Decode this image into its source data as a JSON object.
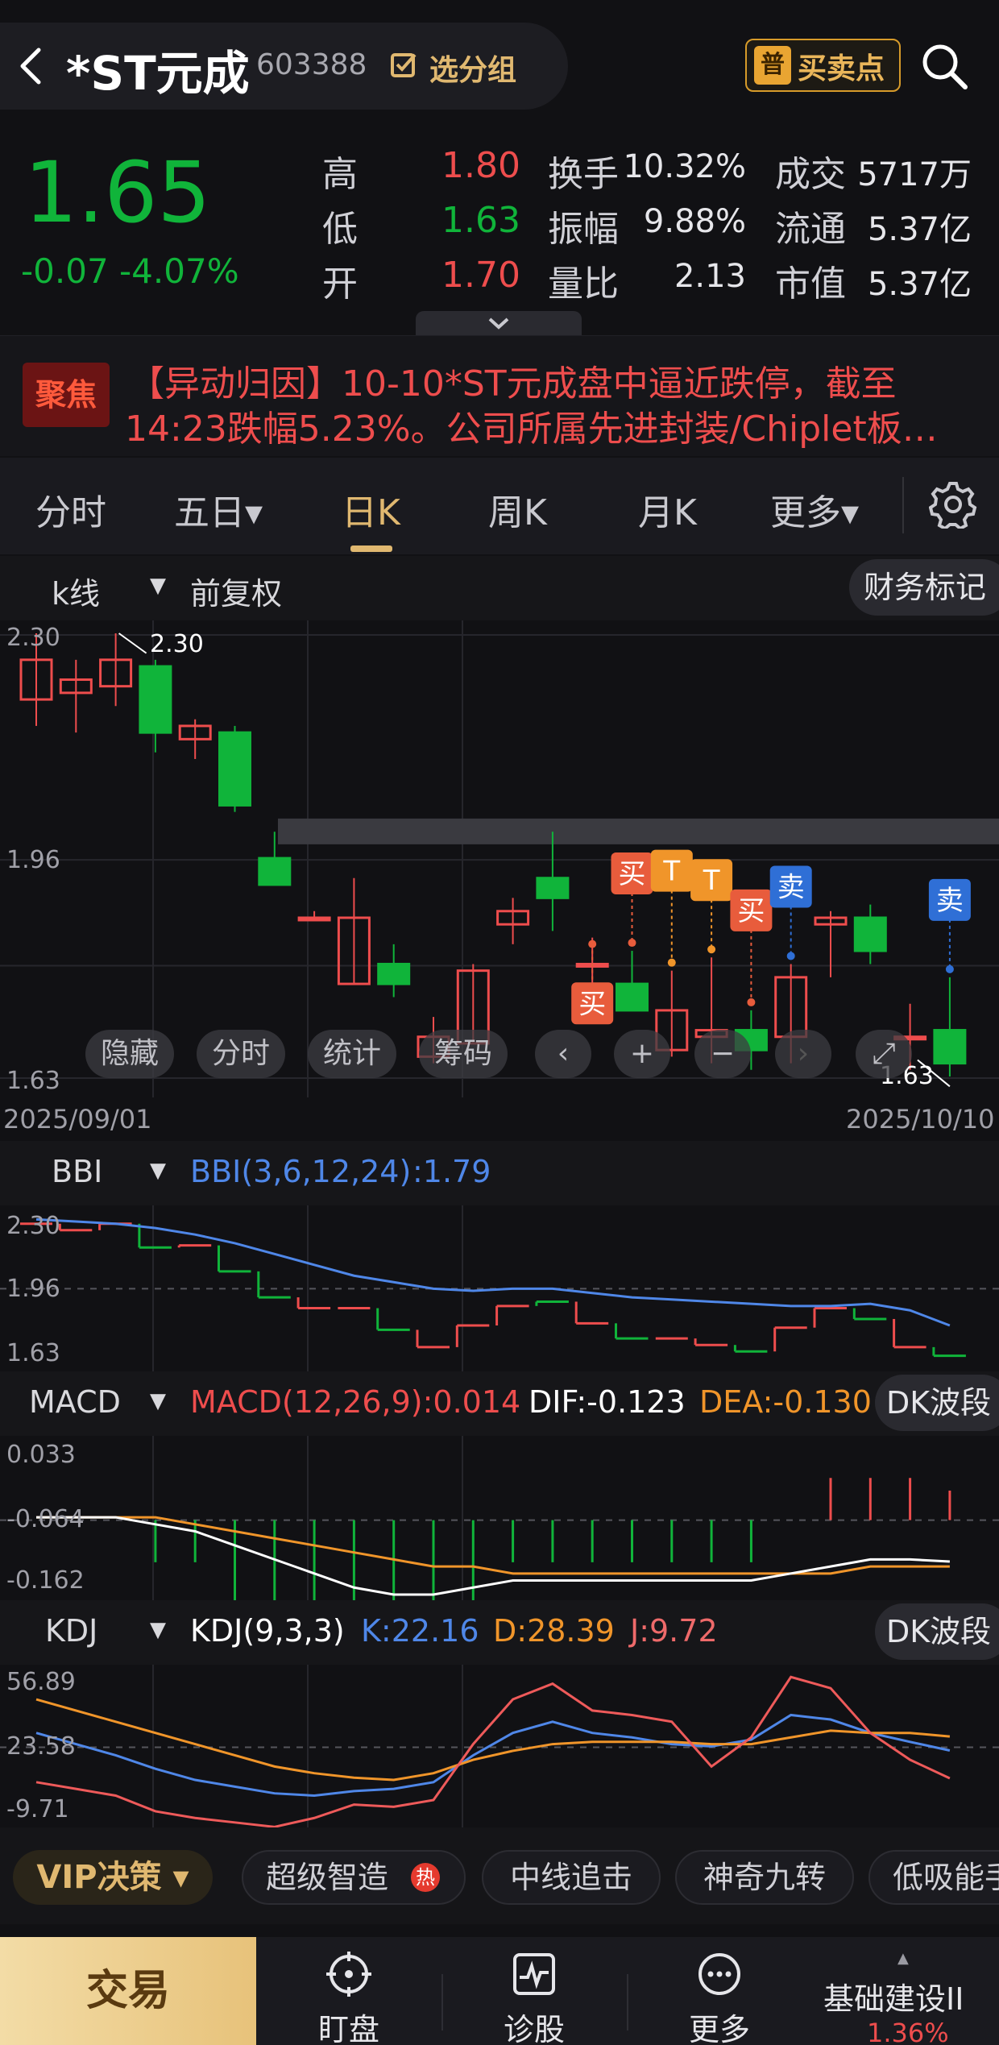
{
  "header": {
    "stock_name": "*ST元成",
    "stock_code": "603388",
    "group_label": "选分组",
    "bs_icon_char": "普",
    "bs_label": "买卖点"
  },
  "quote": {
    "price": "1.65",
    "change": "-0.07 -4.07%",
    "high_label": "高",
    "high": "1.80",
    "low_label": "低",
    "low": "1.63",
    "open_label": "开",
    "open": "1.70",
    "turnover_label": "换手",
    "turnover": "10.32%",
    "amplitude_label": "振幅",
    "amplitude": "9.88%",
    "volratio_label": "量比",
    "volratio": "2.13",
    "volume_label": "成交",
    "volume": "5717万",
    "float_label": "流通",
    "float": "5.37亿",
    "mcap_label": "市值",
    "mcap": "5.37亿"
  },
  "news": {
    "badge": "聚焦",
    "line1": "【异动归因】10-10*ST元成盘中逼近跌停，截至",
    "line2": "14:23跌幅5.23%。公司所属先进封装/Chiplet板块……"
  },
  "tabs": [
    {
      "label": "分时"
    },
    {
      "label": "五日▾"
    },
    {
      "label": "日K"
    },
    {
      "label": "周K"
    },
    {
      "label": "月K"
    },
    {
      "label": "更多▾"
    }
  ],
  "kline": {
    "indicator": "k线",
    "adjust": "前复权",
    "finance_tag": "财务标记",
    "y_high": "2.30",
    "y_mid": "1.96",
    "y_low": "1.63",
    "max_label": "2.30",
    "min_label": "1.63",
    "date_start": "2025/09/01",
    "date_end": "2025/10/10",
    "overlay": {
      "hide": "隐藏",
      "intraday": "分时",
      "stats": "统计",
      "chips": "筹码"
    },
    "signals": {
      "buy": "买",
      "sell": "卖",
      "t": "T"
    }
  },
  "bbi": {
    "name": "BBI",
    "label": "BBI(3,6,12,24)",
    "value": ":1.79",
    "y_high": "2.30",
    "y_mid": "1.96",
    "y_low": "1.63"
  },
  "macd": {
    "name": "MACD",
    "label": "MACD(12,26,9):0.014",
    "dif": "DIF:-0.123",
    "dea": "DEA:-0.130",
    "dk": "DK波段",
    "y_high": "0.033",
    "y_mid": "-0.064",
    "y_low": "-0.162"
  },
  "kdj": {
    "name": "KDJ",
    "label": "KDJ(9,3,3)",
    "k": "K:22.16",
    "d": "D:28.39",
    "j": "J:9.72",
    "dk": "DK波段",
    "y_high": "56.89",
    "y_mid": "23.58",
    "y_low": "-9.71"
  },
  "strategy": {
    "vip": "VIP决策 ▾",
    "items": [
      "超级智造",
      "中线追击",
      "神奇九转",
      "低吸能手"
    ],
    "hot": "热"
  },
  "nav": {
    "trade": "交易",
    "watch": "盯盘",
    "diagnose": "诊股",
    "more": "更多",
    "sector_name": "基础建设II",
    "sector_change": "1.36%"
  },
  "colors": {
    "up": "#ee4d4d",
    "down": "#10b43a",
    "accent": "#e0b870",
    "bbi": "#4f87e8",
    "dea": "#f0952a"
  },
  "chart_data": [
    {
      "type": "candlestick",
      "title": "k线 前复权",
      "x": [
        "2025/09/01",
        "2025/10/10"
      ],
      "ylim": [
        1.63,
        2.3
      ],
      "candles": [
        {
          "o": 2.2,
          "h": 2.3,
          "l": 2.16,
          "c": 2.26
        },
        {
          "o": 2.21,
          "h": 2.26,
          "l": 2.15,
          "c": 2.23
        },
        {
          "o": 2.22,
          "h": 2.3,
          "l": 2.19,
          "c": 2.26
        },
        {
          "o": 2.25,
          "h": 2.26,
          "l": 2.12,
          "c": 2.15
        },
        {
          "o": 2.14,
          "h": 2.17,
          "l": 2.11,
          "c": 2.16
        },
        {
          "o": 2.15,
          "h": 2.16,
          "l": 2.03,
          "c": 2.04
        },
        {
          "o": 1.96,
          "h": 2.0,
          "l": 1.95,
          "c": 1.92
        },
        {
          "o": 1.87,
          "h": 1.88,
          "l": 1.87,
          "c": 1.87
        },
        {
          "o": 1.77,
          "h": 1.93,
          "l": 1.77,
          "c": 1.87
        },
        {
          "o": 1.8,
          "h": 1.83,
          "l": 1.75,
          "c": 1.77
        },
        {
          "o": 1.66,
          "h": 1.72,
          "l": 1.65,
          "c": 1.69
        },
        {
          "o": 1.68,
          "h": 1.8,
          "l": 1.68,
          "c": 1.79
        },
        {
          "o": 1.86,
          "h": 1.9,
          "l": 1.83,
          "c": 1.88
        },
        {
          "o": 1.93,
          "h": 2.0,
          "l": 1.85,
          "c": 1.9
        },
        {
          "o": 1.8,
          "h": 1.84,
          "l": 1.76,
          "c": 1.8
        },
        {
          "o": 1.77,
          "h": 1.82,
          "l": 1.73,
          "c": 1.73
        },
        {
          "o": 1.67,
          "h": 1.79,
          "l": 1.66,
          "c": 1.73
        },
        {
          "o": 1.69,
          "h": 1.81,
          "l": 1.65,
          "c": 1.7
        },
        {
          "o": 1.7,
          "h": 1.73,
          "l": 1.64,
          "c": 1.67
        },
        {
          "o": 1.69,
          "h": 1.8,
          "l": 1.65,
          "c": 1.78
        },
        {
          "o": 1.86,
          "h": 1.88,
          "l": 1.78,
          "c": 1.87
        },
        {
          "o": 1.87,
          "h": 1.89,
          "l": 1.8,
          "c": 1.82
        },
        {
          "o": 1.69,
          "h": 1.74,
          "l": 1.64,
          "c": 1.69
        },
        {
          "o": 1.7,
          "h": 1.78,
          "l": 1.63,
          "c": 1.65
        }
      ],
      "signals": [
        {
          "i": 14,
          "label": "买",
          "side": "low"
        },
        {
          "i": 15,
          "label": "买",
          "side": "high"
        },
        {
          "i": 16,
          "label": "T",
          "side": "high"
        },
        {
          "i": 17,
          "label": "T",
          "side": "high"
        },
        {
          "i": 18,
          "label": "买",
          "side": "high"
        },
        {
          "i": 19,
          "label": "卖",
          "side": "high"
        },
        {
          "i": 23,
          "label": "卖",
          "side": "high"
        }
      ]
    },
    {
      "type": "line",
      "title": "BBI(3,6,12,24)",
      "ylim": [
        1.63,
        2.3
      ],
      "series": [
        {
          "name": "BBI",
          "values": [
            2.28,
            2.27,
            2.26,
            2.24,
            2.21,
            2.17,
            2.12,
            2.07,
            2.02,
            1.99,
            1.96,
            1.95,
            1.96,
            1.96,
            1.94,
            1.92,
            1.91,
            1.9,
            1.89,
            1.88,
            1.88,
            1.89,
            1.86,
            1.79
          ]
        }
      ]
    },
    {
      "type": "line",
      "title": "MACD(12,26,9)",
      "ylim": [
        -0.162,
        0.033
      ],
      "series": [
        {
          "name": "DIF",
          "values": [
            -0.06,
            -0.06,
            -0.06,
            -0.07,
            -0.08,
            -0.1,
            -0.12,
            -0.14,
            -0.16,
            -0.17,
            -0.17,
            -0.16,
            -0.15,
            -0.15,
            -0.15,
            -0.15,
            -0.15,
            -0.15,
            -0.15,
            -0.14,
            -0.13,
            -0.12,
            -0.12,
            -0.123
          ]
        },
        {
          "name": "DEA",
          "values": [
            -0.06,
            -0.06,
            -0.06,
            -0.06,
            -0.07,
            -0.08,
            -0.09,
            -0.1,
            -0.11,
            -0.12,
            -0.13,
            -0.13,
            -0.14,
            -0.14,
            -0.14,
            -0.14,
            -0.14,
            -0.14,
            -0.14,
            -0.14,
            -0.14,
            -0.13,
            -0.13,
            -0.13
          ]
        }
      ]
    },
    {
      "type": "line",
      "title": "KDJ(9,3,3)",
      "ylim": [
        -9.71,
        56.89
      ],
      "series": [
        {
          "name": "K",
          "values": [
            30,
            25,
            20,
            14,
            9,
            6,
            3,
            2,
            4,
            5,
            8,
            20,
            30,
            35,
            30,
            28,
            25,
            24,
            27,
            38,
            36,
            30,
            26,
            22.16
          ]
        },
        {
          "name": "D",
          "values": [
            45,
            40,
            35,
            30,
            25,
            20,
            15,
            12,
            10,
            9,
            12,
            18,
            22,
            25,
            26,
            26,
            26,
            25,
            25,
            28,
            31,
            30,
            30,
            28.39
          ]
        },
        {
          "name": "J",
          "values": [
            8,
            5,
            2,
            -5,
            -8,
            -10,
            -12,
            -8,
            -2,
            -3,
            0,
            25,
            45,
            52,
            40,
            38,
            35,
            15,
            28,
            55,
            50,
            30,
            18,
            9.72
          ]
        }
      ]
    }
  ]
}
